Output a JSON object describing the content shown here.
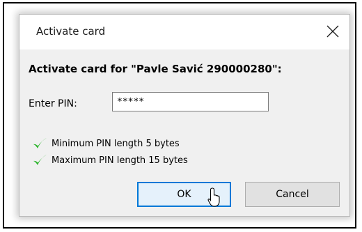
{
  "dialog": {
    "title": "Activate card",
    "heading": "Activate card for \"Pavle Savić 290000280\":",
    "pin_label": "Enter PIN:",
    "pin_value": "*****",
    "requirements": [
      {
        "text": "Minimum PIN length 5 bytes",
        "icon": "checkmark-icon"
      },
      {
        "text": "Maximum PIN length 15 bytes",
        "icon": "checkmark-icon"
      }
    ],
    "ok_label": "OK",
    "cancel_label": "Cancel",
    "close_icon": "close-icon"
  },
  "colors": {
    "check": "#2cb52c",
    "ok_border": "#0078d7",
    "ok_background": "#e5f1fb",
    "dialog_background": "#f0f0f0"
  }
}
